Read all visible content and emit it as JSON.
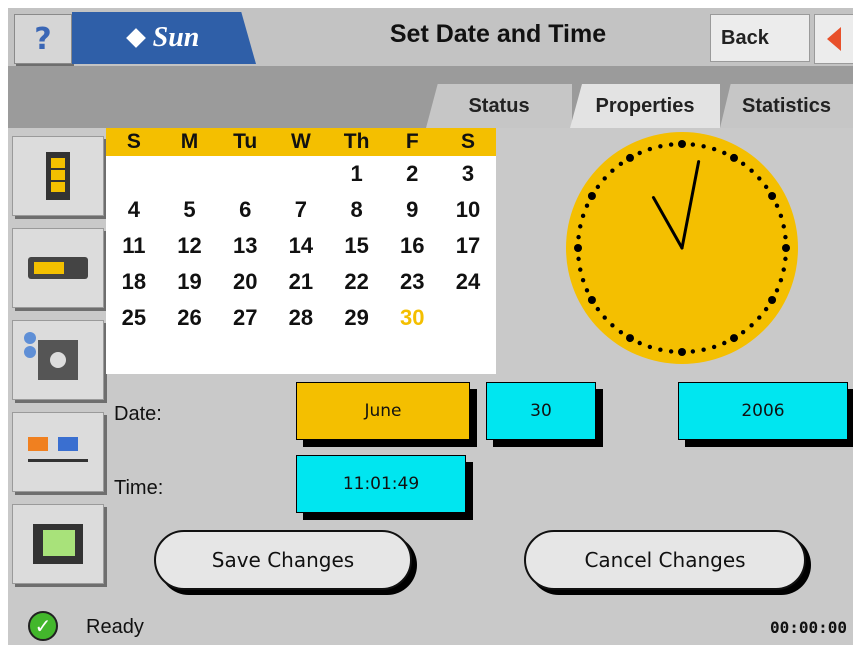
{
  "header": {
    "help_label": "?",
    "logo_text": "Sun",
    "title": "Set Date and Time",
    "back_label": "Back"
  },
  "tabs": [
    {
      "label": "Status"
    },
    {
      "label": "Properties",
      "active": true
    },
    {
      "label": "Statistics"
    }
  ],
  "sidebar": {
    "items": [
      {
        "icon": "storage-cabinet-icon"
      },
      {
        "icon": "disk-drive-icon"
      },
      {
        "icon": "network-settings-icon"
      },
      {
        "icon": "network-nodes-icon"
      },
      {
        "icon": "monitor-icon"
      }
    ]
  },
  "calendar": {
    "weekdays": [
      "S",
      "M",
      "Tu",
      "W",
      "Th",
      "F",
      "S"
    ],
    "weeks": [
      [
        "",
        "",
        "",
        "",
        "1",
        "2",
        "3"
      ],
      [
        "4",
        "5",
        "6",
        "7",
        "8",
        "9",
        "10"
      ],
      [
        "11",
        "12",
        "13",
        "14",
        "15",
        "16",
        "17"
      ],
      [
        "18",
        "19",
        "20",
        "21",
        "22",
        "23",
        "24"
      ],
      [
        "25",
        "26",
        "27",
        "28",
        "29",
        "30",
        ""
      ]
    ],
    "selected_day": "30",
    "highlight_color": "#f4bf00"
  },
  "clock": {
    "hour": 11,
    "minute": 1,
    "second": 49,
    "face_color": "#f4bf00"
  },
  "form": {
    "date_label": "Date:",
    "time_label": "Time:",
    "month": "June",
    "day": "30",
    "year": "2006",
    "time": "11:01:49"
  },
  "actions": {
    "save_label": "Save Changes",
    "cancel_label": "Cancel Changes"
  },
  "status": {
    "text": "Ready",
    "time": "00:00:00",
    "icon": "check-icon"
  },
  "colors": {
    "accent_yellow": "#f4bf00",
    "accent_cyan": "#00e6f0",
    "brand_blue": "#2f5fa8"
  }
}
